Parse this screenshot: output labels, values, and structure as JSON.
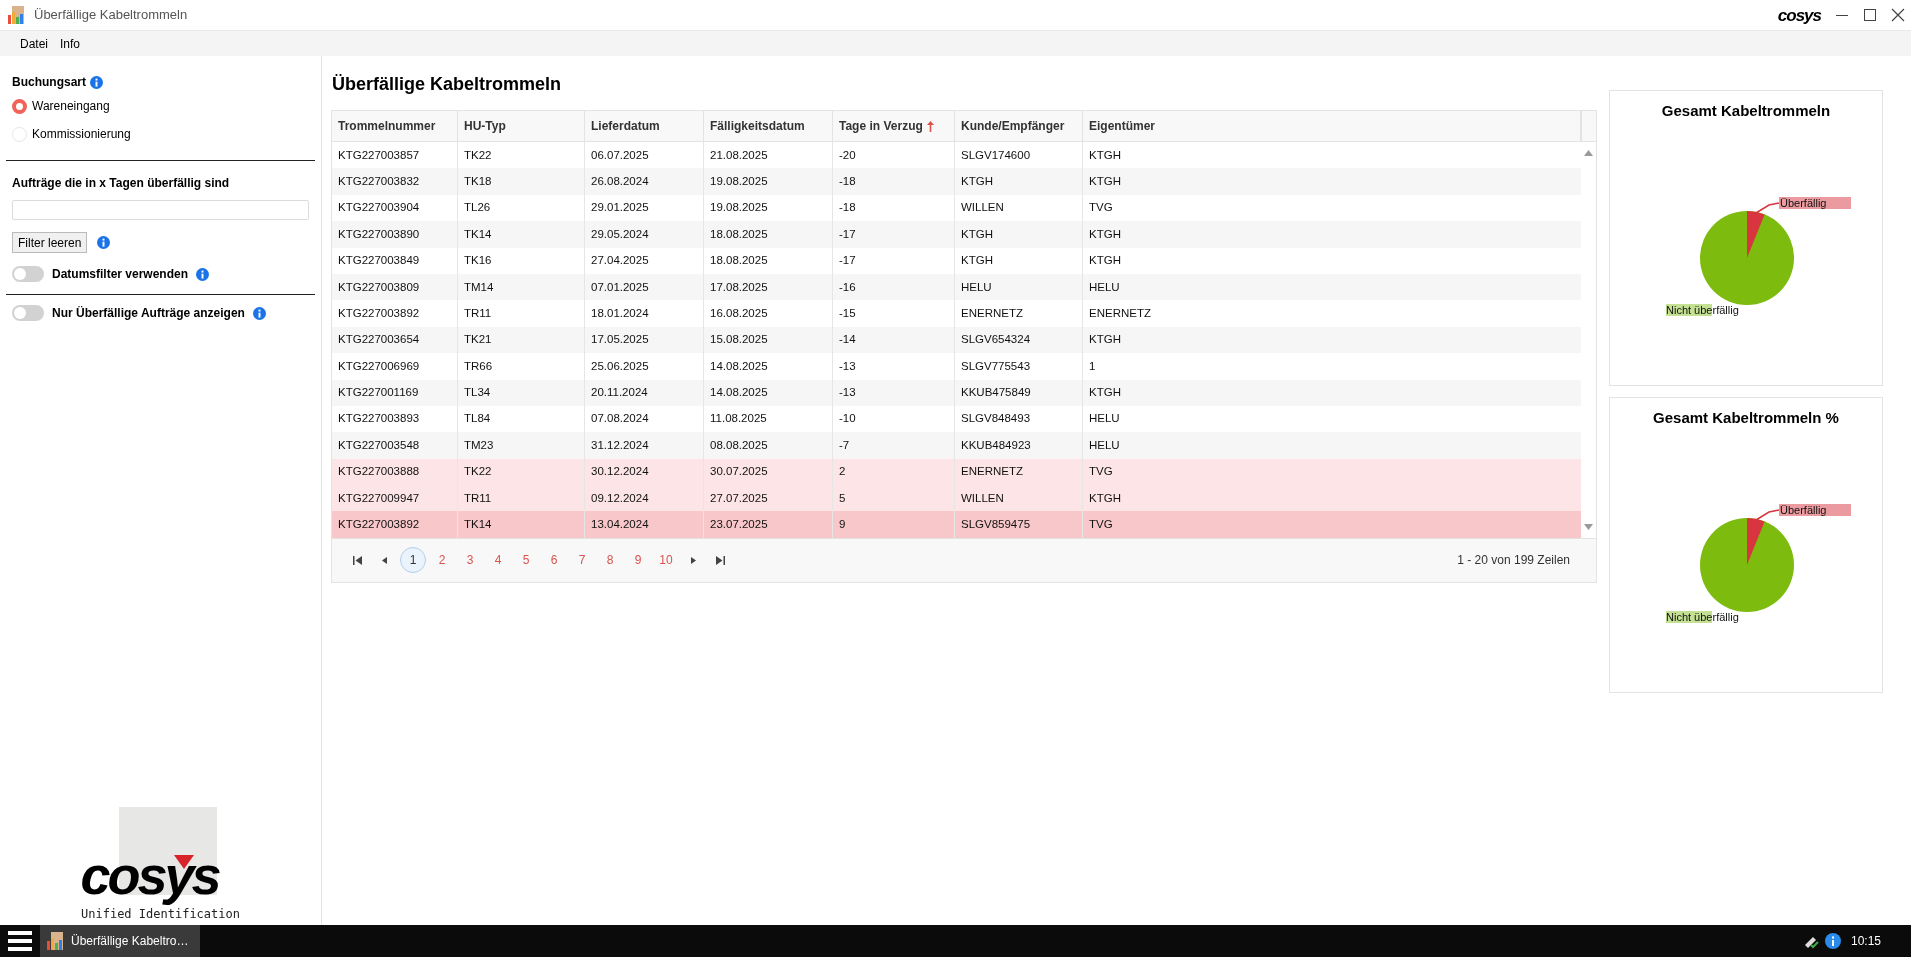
{
  "window": {
    "title": "Überfällige Kabeltrommeln",
    "brand": "cosys"
  },
  "menu": [
    "Datei",
    "Info"
  ],
  "sidebar": {
    "booking_type": {
      "label": "Buchungsart",
      "options": [
        {
          "label": "Wareneingang",
          "selected": true
        },
        {
          "label": "Kommissionierung",
          "selected": false
        }
      ]
    },
    "days_filter": {
      "label": "Aufträge die in x Tagen überfällig sind"
    },
    "clear_button": "Filter leeren",
    "toggles": [
      {
        "label": "Datumsfilter verwenden",
        "on": false
      },
      {
        "label": "Nur Überfällige Aufträge anzeigen",
        "on": false
      }
    ],
    "logo": {
      "text": "cosys",
      "tagline": "Unified Identification"
    }
  },
  "page_title": "Überfällige Kabeltrommeln",
  "table": {
    "columns": [
      {
        "label": "Trommelnummer",
        "sorted": false
      },
      {
        "label": "HU-Typ",
        "sorted": false
      },
      {
        "label": "Lieferdatum",
        "sorted": false
      },
      {
        "label": "Fälligkeitsdatum",
        "sorted": false
      },
      {
        "label": "Tage in Verzug",
        "sorted": true
      },
      {
        "label": "Kunde/Empfänger",
        "sorted": false
      },
      {
        "label": "Eigentümer",
        "sorted": false
      }
    ],
    "rows": [
      {
        "cells": [
          "KTG227003857",
          "TK22",
          "06.07.2025",
          "21.08.2025",
          "-20",
          "SLGV174600",
          "KTGH"
        ],
        "overdue": false,
        "selected": false
      },
      {
        "cells": [
          "KTG227003832",
          "TK18",
          "26.08.2024",
          "19.08.2025",
          "-18",
          "KTGH",
          "KTGH"
        ],
        "overdue": false,
        "selected": false
      },
      {
        "cells": [
          "KTG227003904",
          "TL26",
          "29.01.2025",
          "19.08.2025",
          "-18",
          "WILLEN",
          "TVG"
        ],
        "overdue": false,
        "selected": false
      },
      {
        "cells": [
          "KTG227003890",
          "TK14",
          "29.05.2024",
          "18.08.2025",
          "-17",
          "KTGH",
          "KTGH"
        ],
        "overdue": false,
        "selected": false
      },
      {
        "cells": [
          "KTG227003849",
          "TK16",
          "27.04.2025",
          "18.08.2025",
          "-17",
          "KTGH",
          "KTGH"
        ],
        "overdue": false,
        "selected": false
      },
      {
        "cells": [
          "KTG227003809",
          "TM14",
          "07.01.2025",
          "17.08.2025",
          "-16",
          "HELU",
          "HELU"
        ],
        "overdue": false,
        "selected": false
      },
      {
        "cells": [
          "KTG227003892",
          "TR11",
          "18.01.2024",
          "16.08.2025",
          "-15",
          "ENERNETZ",
          "ENERNETZ"
        ],
        "overdue": false,
        "selected": false
      },
      {
        "cells": [
          "KTG227003654",
          "TK21",
          "17.05.2025",
          "15.08.2025",
          "-14",
          "SLGV654324",
          "KTGH"
        ],
        "overdue": false,
        "selected": false
      },
      {
        "cells": [
          "KTG227006969",
          "TR66",
          "25.06.2025",
          "14.08.2025",
          "-13",
          "SLGV775543",
          "1"
        ],
        "overdue": false,
        "selected": false
      },
      {
        "cells": [
          "KTG227001169",
          "TL34",
          "20.11.2024",
          "14.08.2025",
          "-13",
          "KKUB475849",
          "KTGH"
        ],
        "overdue": false,
        "selected": false
      },
      {
        "cells": [
          "KTG227003893",
          "TL84",
          "07.08.2024",
          "11.08.2025",
          "-10",
          "SLGV848493",
          "HELU"
        ],
        "overdue": false,
        "selected": false
      },
      {
        "cells": [
          "KTG227003548",
          "TM23",
          "31.12.2024",
          "08.08.2025",
          "-7",
          "KKUB484923",
          "HELU"
        ],
        "overdue": false,
        "selected": false
      },
      {
        "cells": [
          "KTG227003888",
          "TK22",
          "30.12.2024",
          "30.07.2025",
          "2",
          "ENERNETZ",
          "TVG"
        ],
        "overdue": true,
        "selected": false
      },
      {
        "cells": [
          "KTG227009947",
          "TR11",
          "09.12.2024",
          "27.07.2025",
          "5",
          "WILLEN",
          "KTGH"
        ],
        "overdue": true,
        "selected": false
      },
      {
        "cells": [
          "KTG227003892",
          "TK14",
          "13.04.2024",
          "23.07.2025",
          "9",
          "SLGV859475",
          "TVG"
        ],
        "overdue": true,
        "selected": true
      }
    ],
    "pages": [
      {
        "label": "1",
        "selected": true
      },
      {
        "label": "2",
        "selected": false
      },
      {
        "label": "3",
        "selected": false
      },
      {
        "label": "4",
        "selected": false
      },
      {
        "label": "5",
        "selected": false
      },
      {
        "label": "6",
        "selected": false
      },
      {
        "label": "7",
        "selected": false
      },
      {
        "label": "8",
        "selected": false
      },
      {
        "label": "9",
        "selected": false
      },
      {
        "label": "10",
        "selected": false
      }
    ],
    "summary": "1 - 20 von 199 Zeilen"
  },
  "charts": [
    {
      "title": "Gesamt Kabeltrommeln",
      "slices": [
        {
          "label": "Überfällig",
          "color": "#d8353f"
        },
        {
          "label": "Nicht überfällig",
          "color": "#7dbb0e"
        }
      ]
    },
    {
      "title": "Gesamt Kabeltrommeln %",
      "slices": [
        {
          "label": "Überfällig",
          "color": "#d8353f"
        },
        {
          "label": "Nicht überfällig",
          "color": "#7dbb0e"
        }
      ]
    }
  ],
  "taskbar": {
    "task": "Überfällige Kabeltro…",
    "clock": "10:15"
  }
}
